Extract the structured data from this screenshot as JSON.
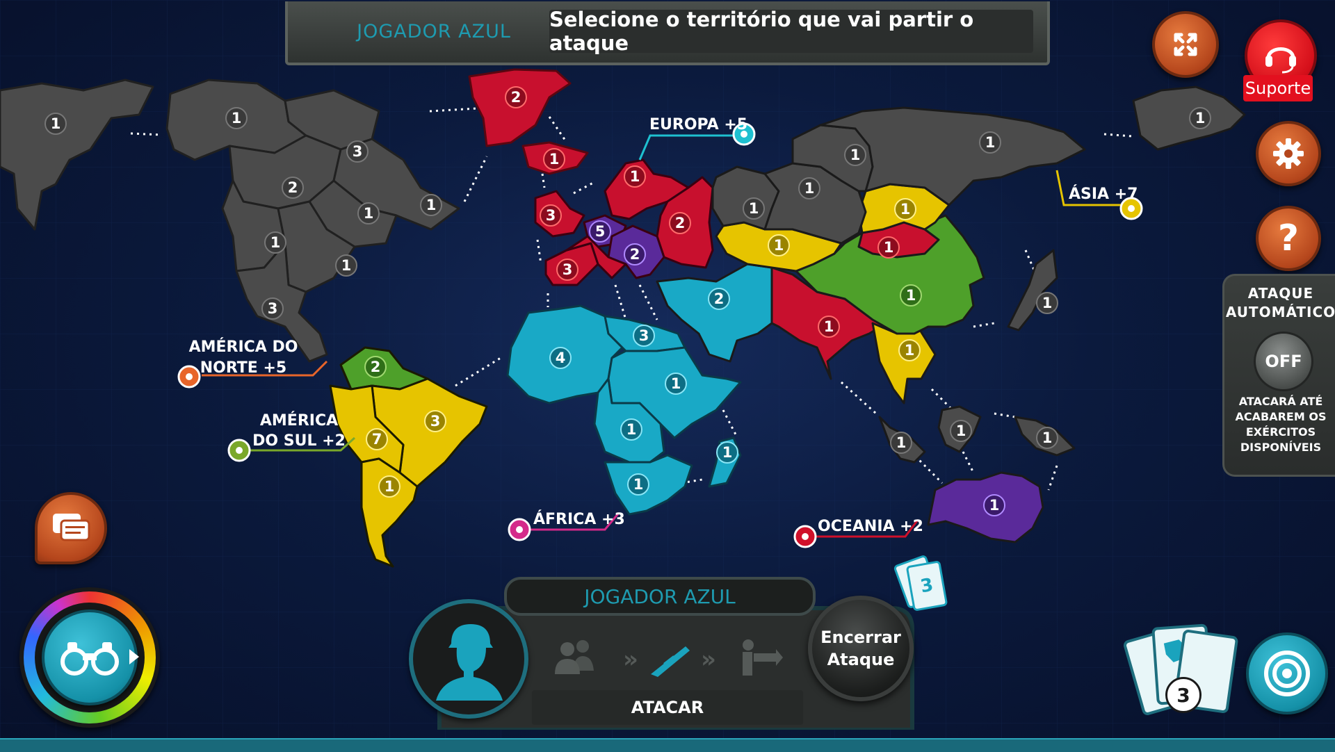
{
  "topbar": {
    "player": "JOGADOR AZUL",
    "instruction": "Selecione o território que vai partir o ataque"
  },
  "buttons": {
    "suporte": "Suporte",
    "help": "?"
  },
  "auto_attack": {
    "title_line1": "ATAQUE",
    "title_line2": "AUTOMÁTICO",
    "state": "OFF",
    "desc_line1": "ATACARÁ ATÉ",
    "desc_line2": "ACABAREM OS",
    "desc_line3": "EXÉRCITOS",
    "desc_line4": "DISPONÍVEIS"
  },
  "continents": {
    "north_america_l1": "AMÉRICA DO",
    "north_america_l2": "NORTE +5",
    "south_america_l1": "AMÉRICA",
    "south_america_l2": "DO SUL +2",
    "europe": "EUROPA +5",
    "africa": "ÁFRICA +3",
    "asia": "ÁSIA +7",
    "oceania": "OCEANIA +2"
  },
  "colors": {
    "gray": "#4b4b4b",
    "red": "#c8102e",
    "yellow": "#e6c400",
    "green": "#4ea02a",
    "blue": "#19a9c6",
    "purple": "#5a2a9a",
    "accent_teal": "#1e9bb0"
  },
  "armies": {
    "alaska": "1",
    "nw_territory": "1",
    "greenland": "2",
    "iceland": "1",
    "alberta": "3",
    "ontario": "2",
    "labrador": "1",
    "quebec": "1",
    "vancouver": "1",
    "new_york": "1",
    "california": "3",
    "mexico": "2",
    "venezuela": "2",
    "brazil": "3",
    "peru": "7",
    "argentina": "1",
    "uk": "3",
    "scandinavia": "1",
    "moscow": "2",
    "germany": "5",
    "poland": "2",
    "portugal": "3",
    "algeria": "4",
    "egypt": "3",
    "sudan": "1",
    "congo": "1",
    "south_africa": "1",
    "madagascar": "1",
    "middle_east": "2",
    "india": "1",
    "vietnam": "1",
    "china": "1",
    "mongolia": "1",
    "aral": "1",
    "omsk": "1",
    "dudinka": "1",
    "siberia": "1",
    "tchita": "1",
    "vladivostok": "1",
    "japan": "1",
    "sumatra": "1",
    "borneo": "1",
    "new_guinea": "1",
    "australia": "1",
    "orient_middle": "1"
  },
  "bottom": {
    "player": "JOGADOR AZUL",
    "phase": "ATACAR",
    "end_attack_l1": "Encerrar",
    "end_attack_l2": "Ataque",
    "cards_pending": "3",
    "cards_count": "3"
  }
}
